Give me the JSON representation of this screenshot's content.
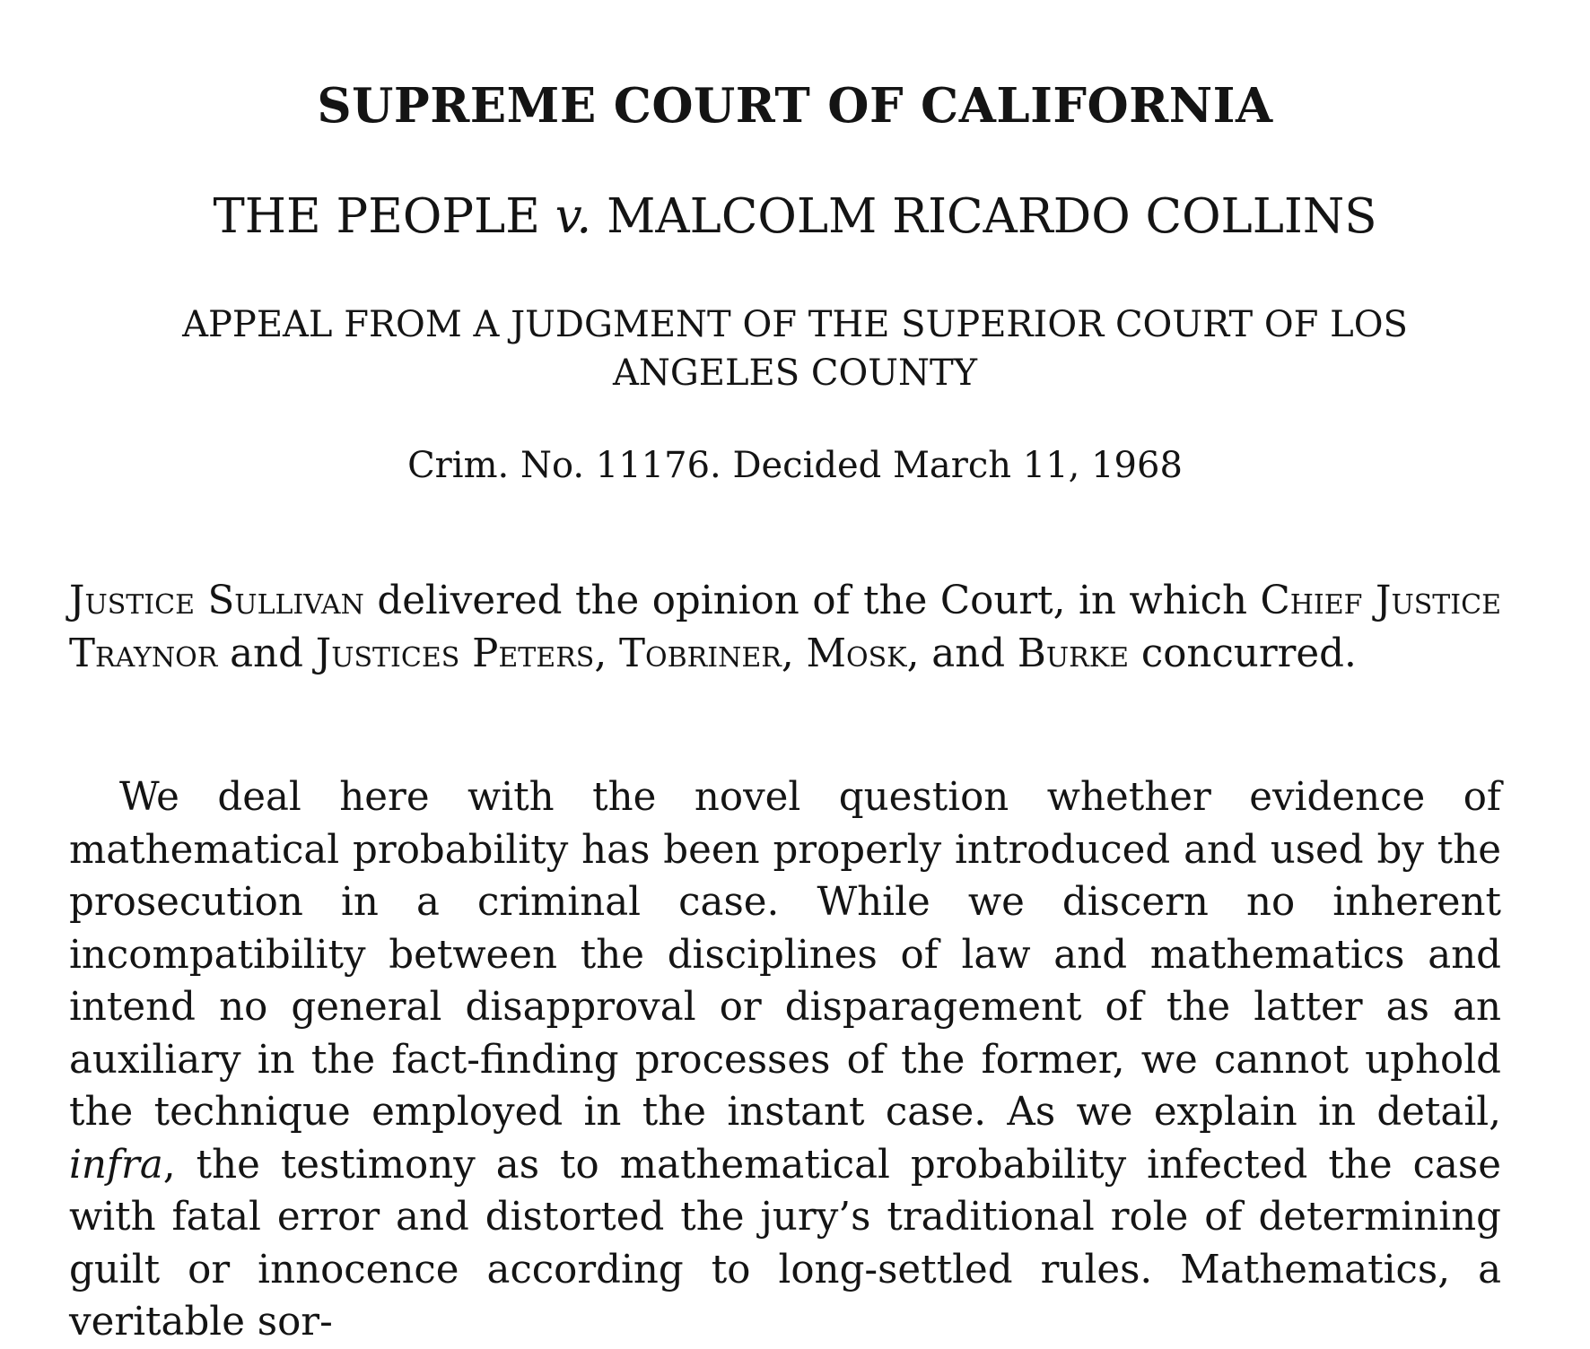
{
  "header": {
    "court": "SUPREME COURT OF CALIFORNIA",
    "case_title_part1": "THE PEOPLE ",
    "case_title_v": "v.",
    "case_title_part2": " MALCOLM RICARDO COLLINS",
    "appeal": "APPEAL FROM A JUDGMENT OF THE SUPERIOR COURT OF LOS ANGELES COUNTY",
    "docket": "Crim. No. 11176. Decided March 11, 1968"
  },
  "authorship": {
    "author": "Justice Sullivan",
    "text1": " delivered the opinion of the Court, in which ",
    "chief": "Chief Justice Traynor",
    "text2": " and ",
    "justices": "Justices Peters",
    "sep1": ", ",
    "j2": "Tobriner",
    "sep2": ", ",
    "j3": "Mosk",
    "sep3": ", and ",
    "j4": "Burke",
    "text3": " concurred."
  },
  "opinion": {
    "p1_a": "We deal here with the novel question whether evidence of mathematical probability has been properly introduced and used by the prosecution in a criminal case. While we discern no inherent incompatibility between the disciplines of law and mathematics and intend no general disapproval or disparagement of the latter as an auxiliary in the fact-finding processes of the former, we cannot uphold the technique employed in the instant case.  As we explain in detail, ",
    "p1_infra": "infra",
    "p1_b": ", the testimony as to mathematical probability infected the case with fatal error and distorted the jury’s traditional role of determining guilt or innocence according to long-settled rules. Mathematics, a veritable sor-"
  }
}
